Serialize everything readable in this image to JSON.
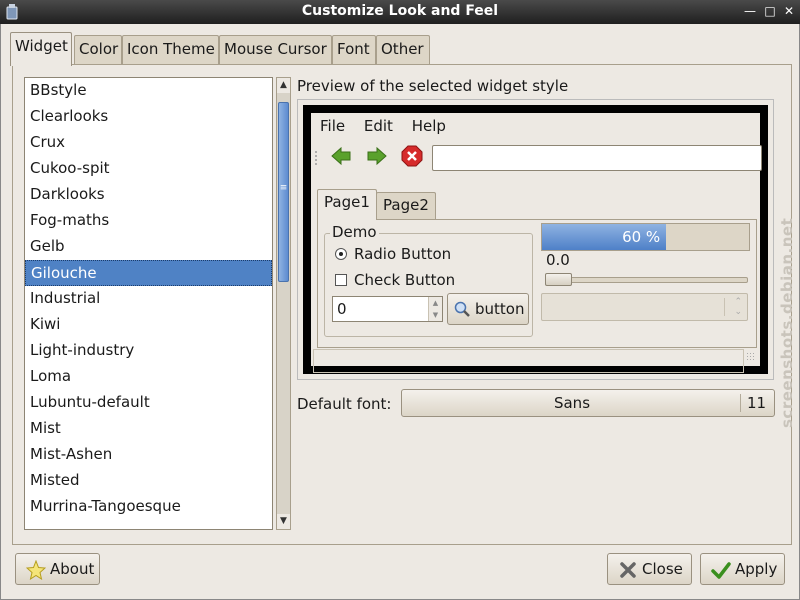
{
  "window": {
    "title": "Customize Look and Feel"
  },
  "tabs": [
    "Widget",
    "Color",
    "Icon Theme",
    "Mouse Cursor",
    "Font",
    "Other"
  ],
  "theme_list": {
    "items": [
      "BBstyle",
      "Clearlooks",
      "Crux",
      "Cukoo-spit",
      "Darklooks",
      "Fog-maths",
      "Gelb",
      "Gilouche",
      "Industrial",
      "Kiwi",
      "Light-industry",
      "Loma",
      "Lubuntu-default",
      "Mist",
      "Mist-Ashen",
      "Misted",
      "Murrina-Tangoesque"
    ],
    "selected": "Gilouche"
  },
  "preview": {
    "label": "Preview of the selected widget style",
    "menu": [
      "File",
      "Edit",
      "Help"
    ],
    "tabs": [
      "Page1",
      "Page2"
    ],
    "demo_legend": "Demo",
    "radio_label": "Radio Button",
    "check_label": "Check Button",
    "spin_value": "0",
    "button_label": "button",
    "progress_text": "60 %",
    "progress_fraction": 0.6,
    "scale_value": "0.0"
  },
  "font": {
    "label": "Default font:",
    "name": "Sans",
    "size": "11"
  },
  "buttons": {
    "about": "About",
    "close": "Close",
    "apply": "Apply"
  },
  "watermark": "screenshots.debian.net",
  "colors": {
    "selection": "#4f82c5",
    "titlebar": "#2b2b2b",
    "background": "#ede9e3"
  }
}
